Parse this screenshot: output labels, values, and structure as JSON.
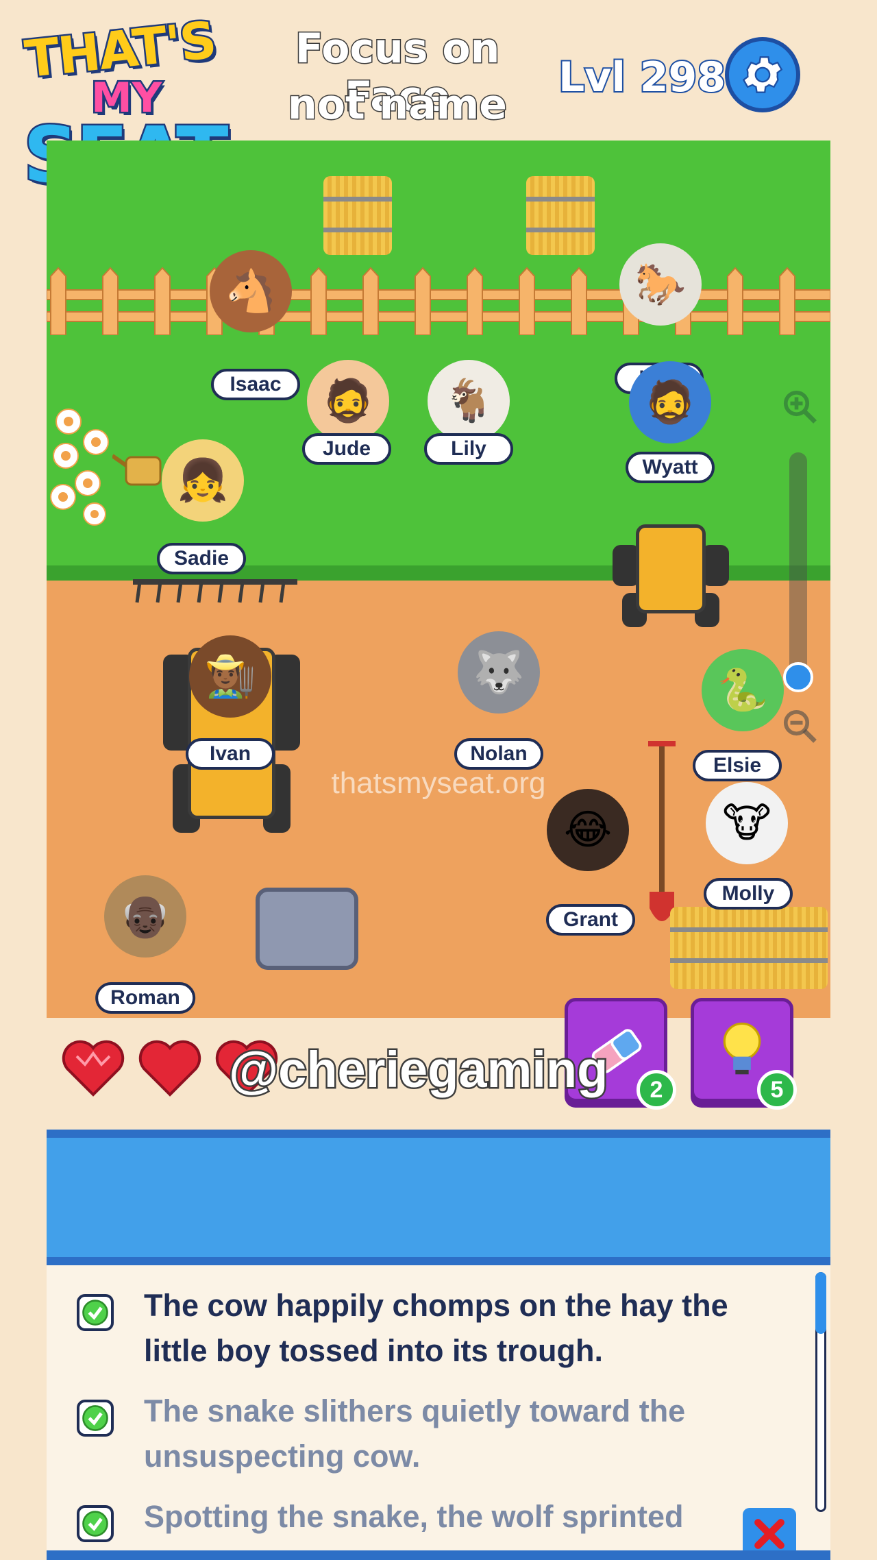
{
  "header": {
    "logo_line1": "THAT'S",
    "logo_line2": "MY",
    "logo_line3": "SEAT",
    "hint_line1": "Focus on Face",
    "hint_line2": "not name",
    "level_label": "Lvl 298",
    "settings_icon": "gear-icon"
  },
  "watermark": "thatsmyseat.org",
  "characters": [
    {
      "name": "Isaac",
      "kind": "horse",
      "icon": "🐴"
    },
    {
      "name": "Lyla",
      "kind": "horse",
      "icon": "🐎"
    },
    {
      "name": "Jude",
      "kind": "person",
      "icon": "🧔"
    },
    {
      "name": "Lily",
      "kind": "goat",
      "icon": "🐐"
    },
    {
      "name": "Wyatt",
      "kind": "person",
      "icon": "🧔"
    },
    {
      "name": "Sadie",
      "kind": "person",
      "icon": "👧"
    },
    {
      "name": "Ivan",
      "kind": "person",
      "icon": "👨🏾‍🌾"
    },
    {
      "name": "Nolan",
      "kind": "wolf",
      "icon": "🐺"
    },
    {
      "name": "Elsie",
      "kind": "snake",
      "icon": "🐍"
    },
    {
      "name": "Molly",
      "kind": "cow",
      "icon": "🐮"
    },
    {
      "name": "Grant",
      "kind": "person",
      "icon": "😂"
    },
    {
      "name": "Roman",
      "kind": "person",
      "icon": "👴🏿"
    }
  ],
  "lives": {
    "total": 3,
    "icon": "heart-icon"
  },
  "overlay_handle": "@cheriegaming",
  "powerups": {
    "eraser": {
      "icon": "eraser-icon",
      "count": "2"
    },
    "hint": {
      "icon": "lightbulb-icon",
      "count": "5"
    }
  },
  "clues": [
    {
      "text": "The cow happily chomps on the hay the little boy tossed into its trough.",
      "checked": true,
      "style": "dark"
    },
    {
      "text": "The snake slithers quietly toward the unsuspecting cow.",
      "checked": true,
      "style": "faded"
    },
    {
      "text": "Spotting the snake, the wolf sprinted",
      "checked": true,
      "style": "faded"
    }
  ],
  "colors": {
    "background": "#f8e6cc",
    "grass": "#4ec23a",
    "dirt": "#eea25e",
    "accent_blue": "#2f8fea",
    "powerup_purple": "#a53bd9",
    "badge_green": "#2db84a",
    "heart_red": "#e32636"
  }
}
